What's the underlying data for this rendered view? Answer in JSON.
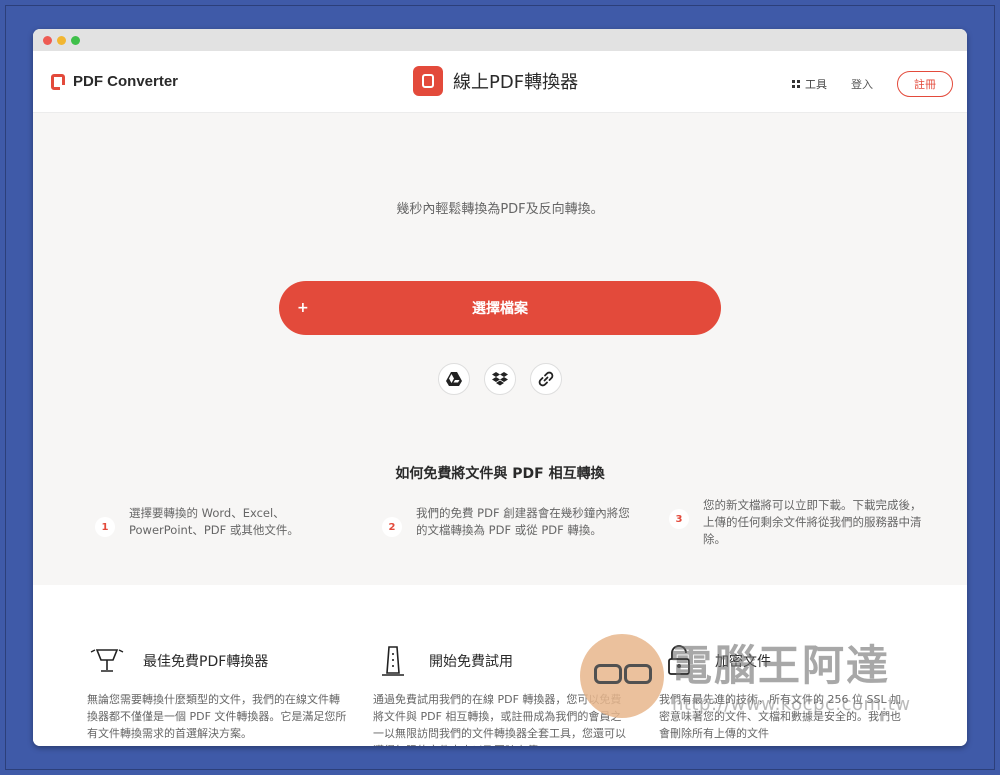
{
  "brand": {
    "name": "PDF Converter"
  },
  "header": {
    "title": "線上PDF轉換器"
  },
  "nav": {
    "tools": "工具",
    "login": "登入",
    "register": "註冊"
  },
  "hero": {
    "subtitle": "幾秒內輕鬆轉換為PDF及反向轉換。",
    "cta_plus": "+",
    "cta_label": "選擇檔案"
  },
  "cloud_sources": [
    "google-drive-icon",
    "dropbox-icon",
    "link-icon"
  ],
  "howto": {
    "title": "如何免費將文件與 PDF 相互轉換",
    "steps": [
      {
        "num": "1",
        "text": "選擇要轉換的 Word、Excel、PowerPoint、PDF 或其他文件。"
      },
      {
        "num": "2",
        "text": "我們的免費 PDF 創建器會在幾秒鐘內將您的文檔轉換為 PDF 或從 PDF 轉換。"
      },
      {
        "num": "3",
        "text": "您的新文檔將可以立即下載。下載完成後，上傳的任何剩余文件將從我們的服務器中清除。"
      }
    ]
  },
  "features": [
    {
      "icon": "trophy-icon",
      "title": "最佳免費PDF轉換器",
      "desc": "無論您需要轉換什麼類型的文件，我們的在線文件轉換器都不僅僅是一個 PDF 文件轉換器。它是滿足您所有文件轉換需求的首選解決方案。"
    },
    {
      "icon": "test-tube-icon",
      "title": "開始免費試用",
      "desc": "通過免費試用我們的在線 PDF 轉換器，您可以免費將文件與 PDF 相互轉換，或註冊成為我們的會員之一以無限訪問我們的文件轉換器全套工具，您還可以獲得無限的文件大小以及同時上傳"
    },
    {
      "icon": "lock-icon",
      "title": "加密文件",
      "desc": "我們有最先進的技術，所有文件的 256 位 SSL 加密意味著您的文件、文檔和數據是安全的。我們也會刪除所有上傳的文件"
    }
  ],
  "watermark": {
    "title": "電腦王阿達",
    "url": "http://www.kocpc.com.tw"
  },
  "colors": {
    "accent": "#e34a3b",
    "frame": "#3f5aa8"
  }
}
